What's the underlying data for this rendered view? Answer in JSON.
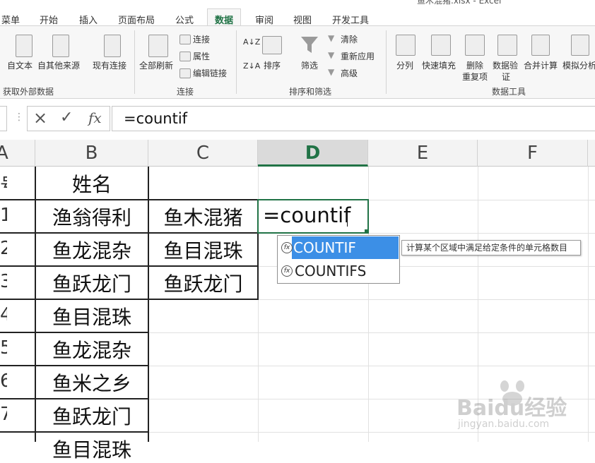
{
  "window": {
    "title": "鱼木混猪.xlsx - Excel"
  },
  "tabs": [
    {
      "label": "菜单"
    },
    {
      "label": "开始"
    },
    {
      "label": "插入"
    },
    {
      "label": "页面布局"
    },
    {
      "label": "公式"
    },
    {
      "label": "数据"
    },
    {
      "label": "审阅"
    },
    {
      "label": "视图"
    },
    {
      "label": "开发工具"
    }
  ],
  "active_tab": "数据",
  "ribbon": {
    "get_external": {
      "from_text": "自文本",
      "from_other": "自其他来源",
      "existing": "现有连接",
      "group": "获取外部数据"
    },
    "connections": {
      "refresh_all": "全部刷新",
      "connections": "连接",
      "properties": "属性",
      "edit_links": "编辑链接",
      "group": "连接"
    },
    "sort_filter": {
      "sort": "排序",
      "filter": "筛选",
      "clear": "清除",
      "reapply": "重新应用",
      "advanced": "高级",
      "group": "排序和筛选"
    },
    "data_tools": {
      "text_to_columns": "分列",
      "flash_fill": "快速填充",
      "remove_dup": "删除\n重复项",
      "remove_dup_1": "删除",
      "remove_dup_2": "重复项",
      "validation_1": "数据验",
      "validation_2": "证",
      "consolidate": "合并计算",
      "whatif": "模拟分析",
      "group": "数据工具"
    }
  },
  "formula_bar": {
    "cancel": "×",
    "enter": "✓",
    "fx": "fx",
    "content": "=countif"
  },
  "columns": [
    "A",
    "B",
    "C",
    "D",
    "E",
    "F"
  ],
  "selected_column": "D",
  "rows": [
    {
      "rownum": "号",
      "b": "姓名",
      "c": ""
    },
    {
      "rownum": "1",
      "b": "渔翁得利",
      "c": "鱼木混猪"
    },
    {
      "rownum": "2",
      "b": "鱼龙混杂",
      "c": "鱼目混珠"
    },
    {
      "rownum": "3",
      "b": "鱼跃龙门",
      "c": "鱼跃龙门"
    },
    {
      "rownum": "4",
      "b": "鱼目混珠",
      "c": ""
    },
    {
      "rownum": "5",
      "b": "鱼龙混杂",
      "c": ""
    },
    {
      "rownum": "6",
      "b": "鱼米之乡",
      "c": ""
    },
    {
      "rownum": "7",
      "b": "鱼跃龙门",
      "c": ""
    },
    {
      "rownum": "",
      "b": "鱼目混珠",
      "c": ""
    }
  ],
  "active_cell": {
    "ref": "D2",
    "value": "=countif"
  },
  "autocomplete": {
    "items": [
      {
        "label": "COUNTIF",
        "icon": "function-icon"
      },
      {
        "label": "COUNTIFS",
        "icon": "function-icon"
      }
    ],
    "tooltip": "计算某个区域中满足给定条件的单元格数目"
  },
  "watermark": {
    "text": "Baidu经验",
    "url": "jingyan.baidu.com"
  },
  "colors": {
    "accent": "#217346",
    "highlight": "#3c8fe6"
  }
}
